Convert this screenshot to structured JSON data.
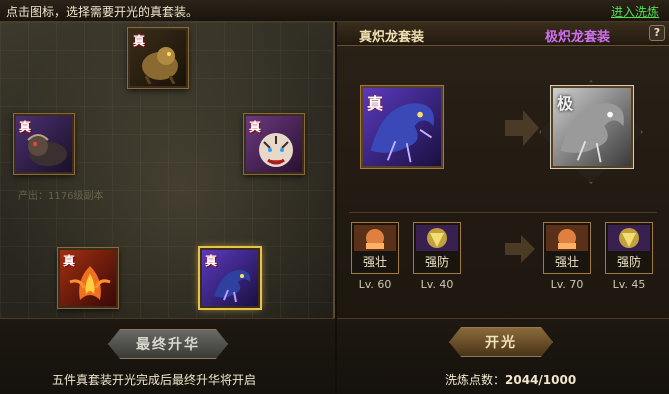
{
  "header": {
    "hint": "点击图标，选择需要开光的真套装。",
    "refine_link": "进入洗炼"
  },
  "left_panel": {
    "ghost_labels": [
      "产出：1176级副本"
    ],
    "slots": [
      {
        "tag": "真",
        "creature": "golden-beast",
        "color": "#7a6030"
      },
      {
        "tag": "真",
        "creature": "dark-lion",
        "color": "#6a4a8a"
      },
      {
        "tag": "真",
        "creature": "white-tiger",
        "color": "#9a5aa0"
      },
      {
        "tag": "真",
        "creature": "fire-phoenix",
        "color": "#c04020"
      },
      {
        "tag": "真",
        "creature": "blue-dragon",
        "color": "#4a3aa0"
      }
    ],
    "final_button": "最终升华",
    "note": "五件真套装开光完成后最终升华将开启"
  },
  "right_panel": {
    "title_left": "真炽龙套装",
    "title_right": "极炽龙套装",
    "help": "?",
    "source": {
      "tag": "真",
      "creature": "blue-dragon"
    },
    "target": {
      "tag": "极",
      "creature": "grey-dragon"
    },
    "skills_before": [
      {
        "name": "强壮",
        "level": "Lv. 60",
        "icon": "strength-icon"
      },
      {
        "name": "强防",
        "level": "Lv. 40",
        "icon": "defense-icon"
      }
    ],
    "skills_after": [
      {
        "name": "强壮",
        "level": "Lv. 70",
        "icon": "strength-icon"
      },
      {
        "name": "强防",
        "level": "Lv. 45",
        "icon": "defense-icon"
      }
    ],
    "open_button": "开光",
    "points_label": "洗炼点数：",
    "points_value": "2044/1000"
  },
  "colors": {
    "accent_gold": "#e8c24a",
    "link_green": "#4ee04e",
    "purple_title": "#d070f0"
  }
}
